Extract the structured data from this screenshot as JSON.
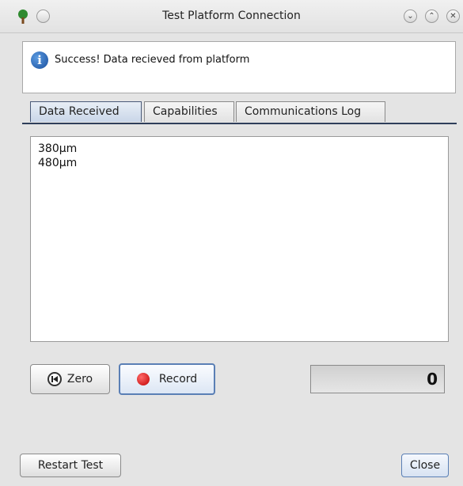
{
  "window": {
    "title": "Test Platform Connection",
    "minimize_glyph": "⌄",
    "maximize_glyph": "⌃",
    "close_glyph": "✕"
  },
  "message": {
    "icon": "info-icon",
    "icon_glyph": "i",
    "text": "Success!  Data recieved from platform"
  },
  "tabs": [
    {
      "label": "Data Received",
      "active": true
    },
    {
      "label": "Capabilities",
      "active": false
    },
    {
      "label": "Communications Log",
      "active": false
    }
  ],
  "data_received": {
    "lines": [
      "380µm",
      "480µm"
    ]
  },
  "controls": {
    "zero_label": "Zero",
    "record_label": "Record",
    "counter_value": "0"
  },
  "footer": {
    "restart_label": "Restart Test",
    "close_label": "Close"
  },
  "colors": {
    "record_red": "#d40000",
    "info_blue": "#1f5fb0",
    "active_tab": "#c9d6e8"
  }
}
